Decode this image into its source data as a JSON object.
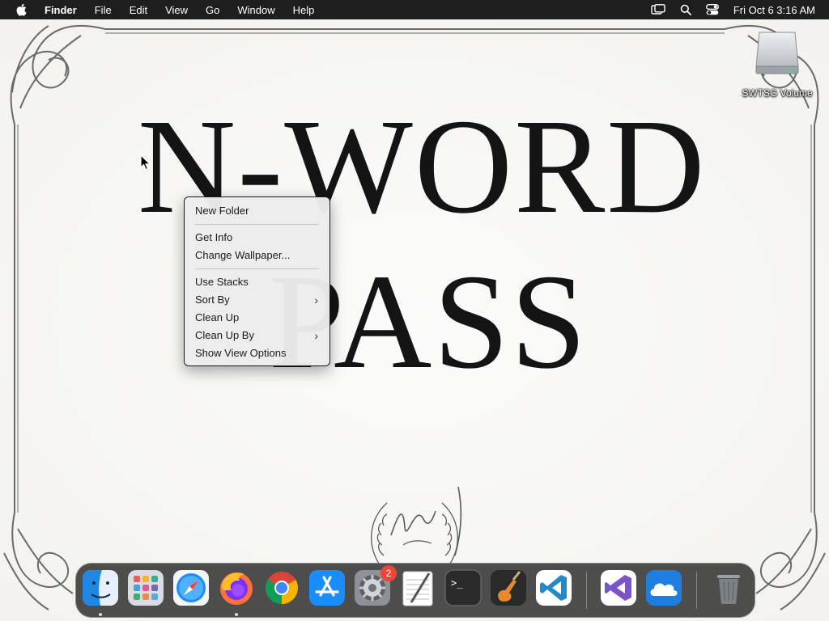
{
  "menubar": {
    "app_name": "Finder",
    "menus": [
      "File",
      "Edit",
      "View",
      "Go",
      "Window",
      "Help"
    ],
    "clock": "Fri Oct 6  3:16 AM",
    "status_icons": [
      "display-icon",
      "search-icon",
      "control-center-icon"
    ]
  },
  "wallpaper": {
    "line1": "N-WORD",
    "line2": "PASS"
  },
  "desktop": {
    "volume_label": "SWTSG Volume"
  },
  "context_menu": {
    "items": [
      {
        "label": "New Folder"
      },
      {
        "label": "Get Info"
      },
      {
        "label": "Change Wallpaper..."
      },
      {
        "label": "Use Stacks"
      },
      {
        "label": "Sort By",
        "submenu": true
      },
      {
        "label": "Clean Up"
      },
      {
        "label": "Clean Up By",
        "submenu": true
      },
      {
        "label": "Show View Options"
      }
    ]
  },
  "dock": {
    "apps": [
      "Finder",
      "Launchpad",
      "Safari",
      "Firefox",
      "Chrome",
      "App Store",
      "System Settings",
      "TextEdit",
      "Terminal",
      "GarageBand",
      "Visual Studio Code",
      "Visual Studio",
      "iCloud Drive",
      "Trash"
    ],
    "settings_badge": "2",
    "colors": {
      "finder": "#1e88e5",
      "safari": "#1d8cf8",
      "appstore": "#1a8dfd",
      "vscode": "#2489ca",
      "visualstudio": "#7b55c7",
      "badge": "#f04438"
    }
  }
}
